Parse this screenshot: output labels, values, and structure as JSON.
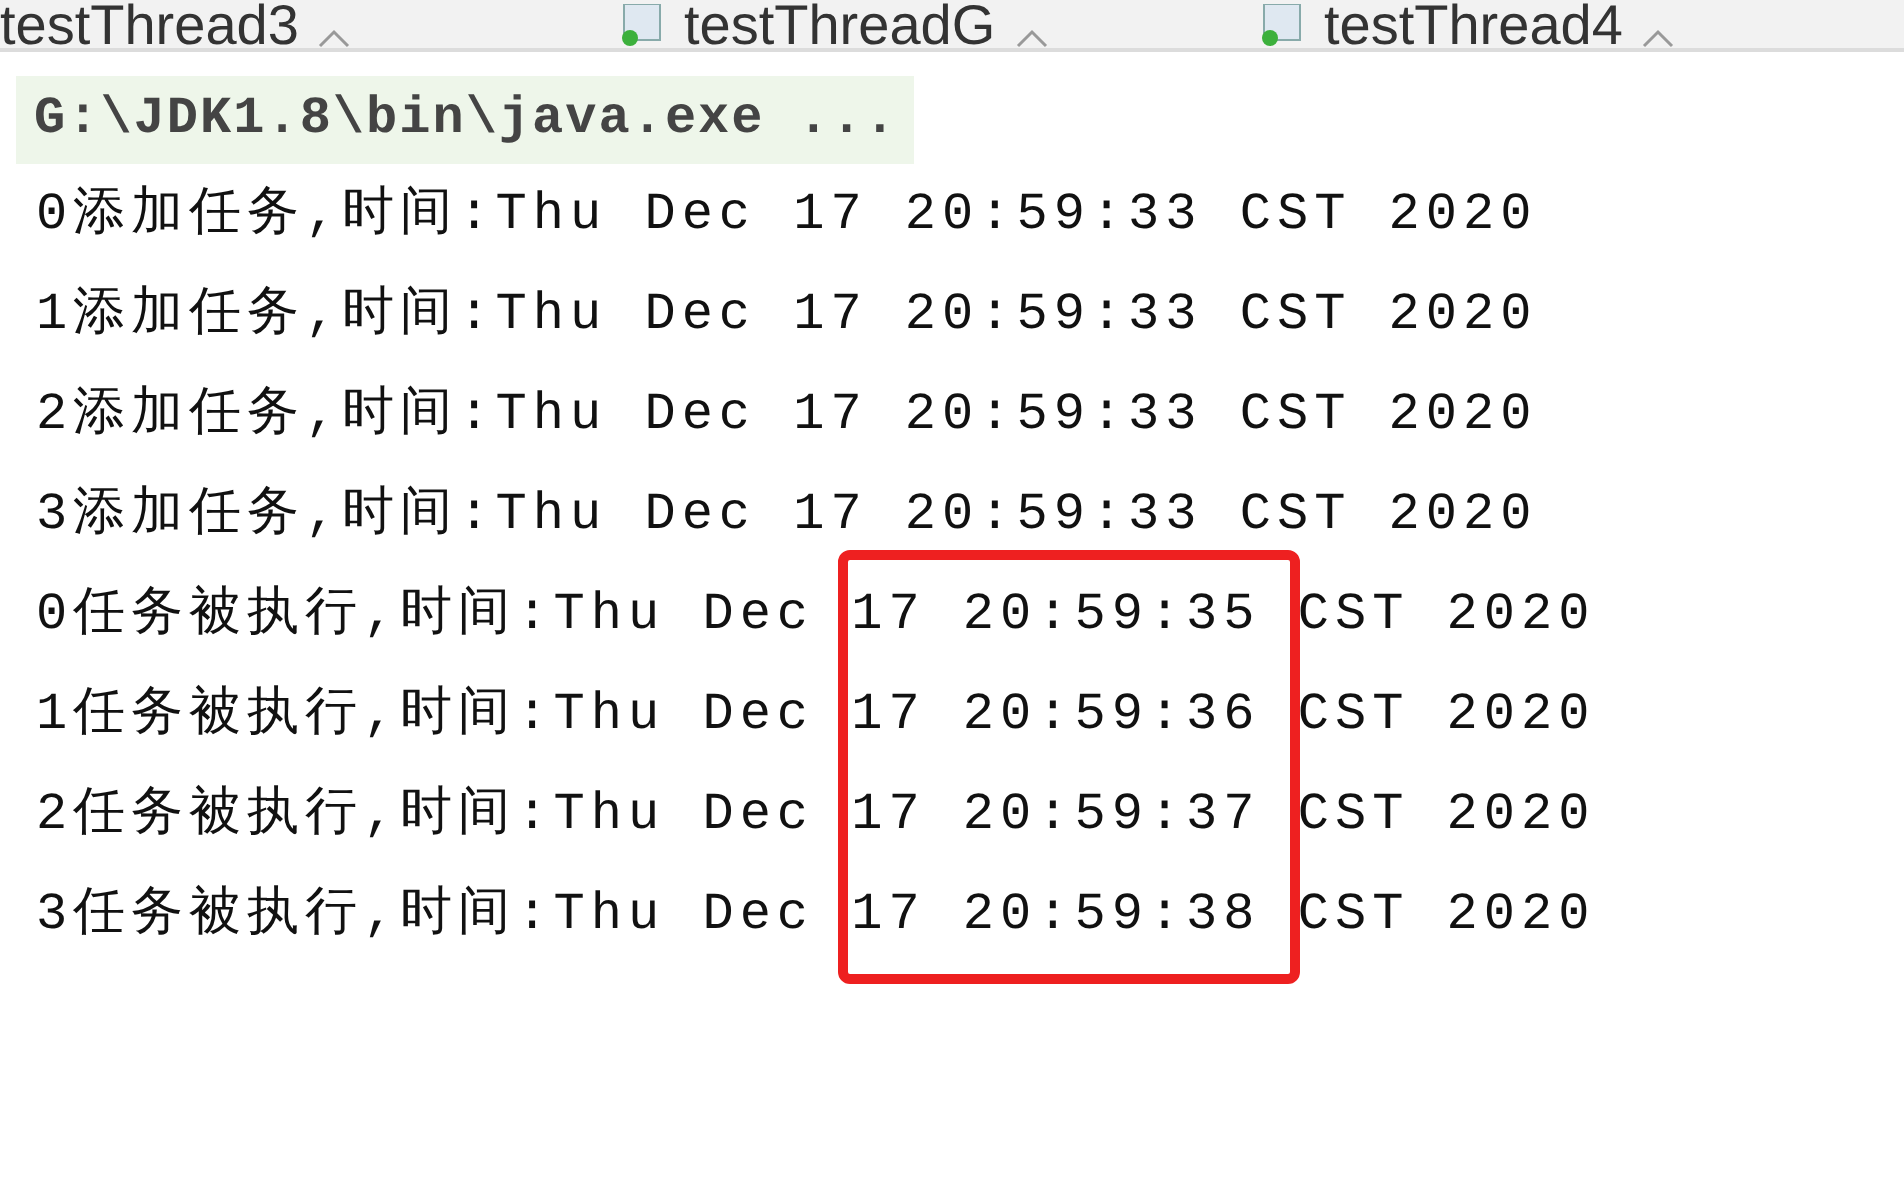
{
  "tabs": [
    {
      "label": "testThread3",
      "selected": false
    },
    {
      "label": "testThreadG",
      "selected": false
    },
    {
      "label": "testThread4",
      "selected": false
    }
  ],
  "console": {
    "command": "G:\\JDK1.8\\bin\\java.exe ...",
    "lines": [
      "0添加任务,时间:Thu Dec 17 20:59:33 CST 2020",
      "1添加任务,时间:Thu Dec 17 20:59:33 CST 2020",
      "2添加任务,时间:Thu Dec 17 20:59:33 CST 2020",
      "3添加任务,时间:Thu Dec 17 20:59:33 CST 2020",
      "0任务被执行,时间:Thu Dec 17 20:59:35 CST 2020",
      "1任务被执行,时间:Thu Dec 17 20:59:36 CST 2020",
      "2任务被执行,时间:Thu Dec 17 20:59:37 CST 2020",
      "3任务被执行,时间:Thu Dec 17 20:59:38 CST 2020"
    ]
  }
}
